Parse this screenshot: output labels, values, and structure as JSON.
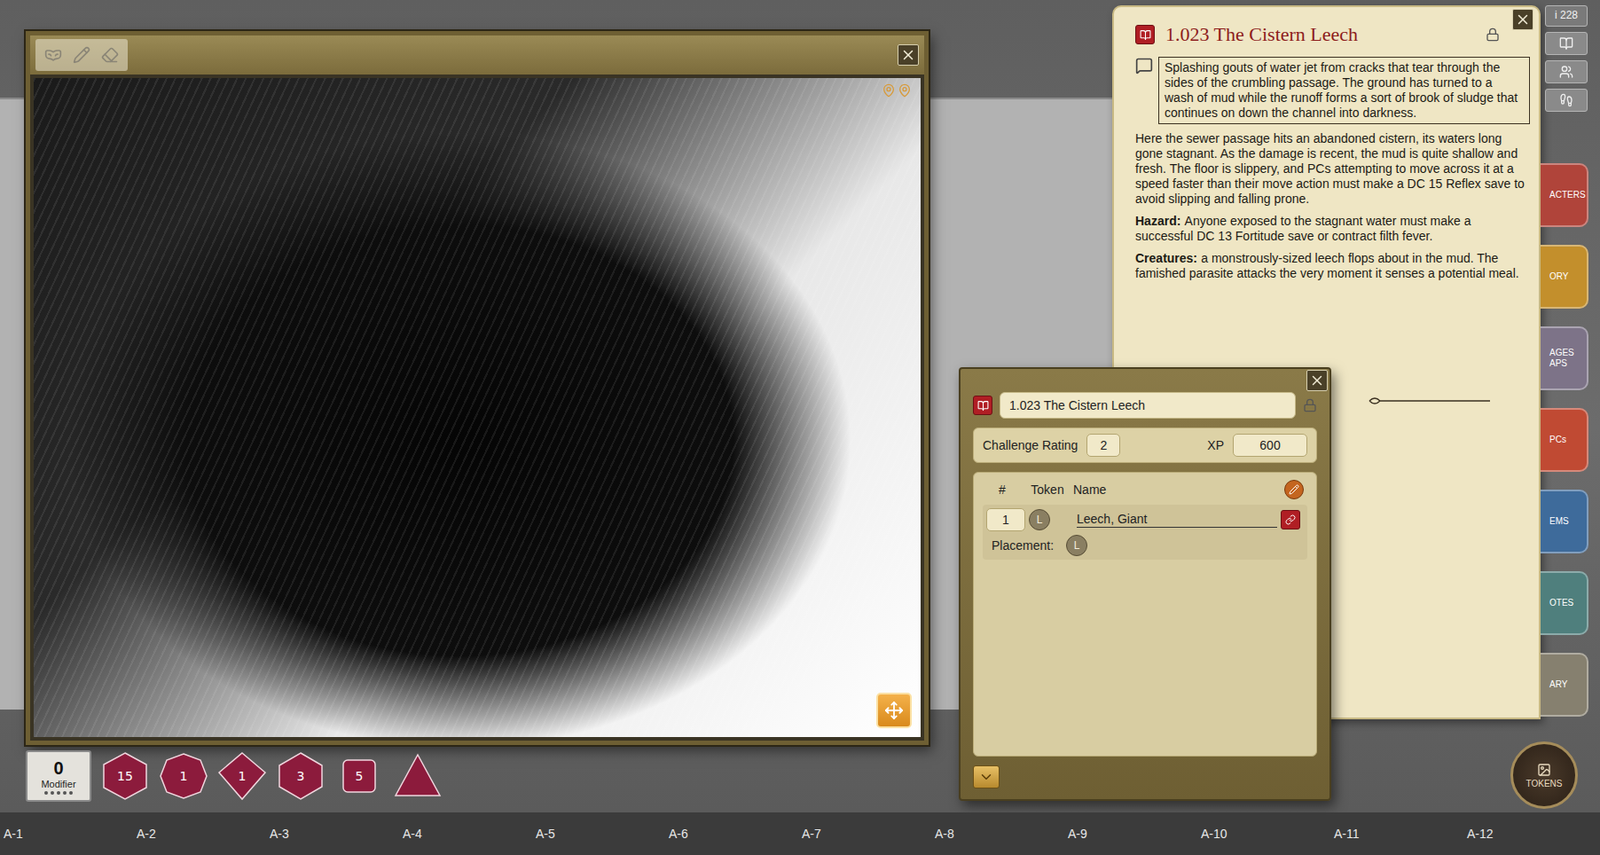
{
  "top_badge": "i 228",
  "story": {
    "title": "1.023 The Cistern Leech",
    "boxed_text": "Splashing gouts of water jet from cracks that tear through the sides of the crumbling passage. The ground has turned to a wash of mud while the runoff forms a sort of brook of sludge that continues on down the channel into darkness.",
    "paragraphs": [
      {
        "label": "",
        "text": "Here the sewer passage hits an abandoned cistern, its waters long gone stagnant. As the damage is recent, the mud is quite shallow and fresh. The floor is slippery, and PCs attempting to move across it at a speed faster than their move action must make a DC 15 Reflex save to avoid slipping and falling prone."
      },
      {
        "label": "Hazard:",
        "text": "Anyone exposed to the stagnant water must make a successful DC 13 Fortitude save or contract filth fever."
      },
      {
        "label": "Creatures:",
        "text": "a monstrously-sized leech flops about in the mud. The famished parasite attacks the very moment it senses a potential meal."
      }
    ]
  },
  "encounter": {
    "name": "1.023 The Cistern Leech",
    "cr_label": "Challenge Rating",
    "cr": "2",
    "xp_label": "XP",
    "xp": "600",
    "columns": [
      "#",
      "Token",
      "Name"
    ],
    "rows": [
      {
        "count": "1",
        "token": "L",
        "name": "Leech, Giant",
        "placement_label": "Placement:",
        "placement_token": "L"
      }
    ]
  },
  "sidebar": [
    {
      "label": "ACTERS",
      "color": "#b0443a"
    },
    {
      "label": "ORY",
      "color": "#c38f2c"
    },
    {
      "label": "AGES APS",
      "color": "#7d7388"
    },
    {
      "label": "PCs",
      "color": "#c04a33"
    },
    {
      "label": "EMS",
      "color": "#3e6b9b"
    },
    {
      "label": "OTES",
      "color": "#4f7f7d"
    },
    {
      "label": "ARY",
      "color": "#86806f"
    }
  ],
  "tokens_button": "TOKENS",
  "modifier": {
    "value": "0",
    "label": "Modifier"
  },
  "dice": [
    {
      "kind": "d20",
      "label": "15"
    },
    {
      "kind": "d12",
      "label": "1"
    },
    {
      "kind": "d10",
      "label": "1"
    },
    {
      "kind": "d8",
      "label": "3"
    },
    {
      "kind": "d6",
      "label": "5"
    },
    {
      "kind": "d4",
      "label": ""
    }
  ],
  "grid_labels": [
    "A-1",
    "A-2",
    "A-3",
    "A-4",
    "A-5",
    "A-6",
    "A-7",
    "A-8",
    "A-9",
    "A-10",
    "A-11",
    "A-12"
  ]
}
